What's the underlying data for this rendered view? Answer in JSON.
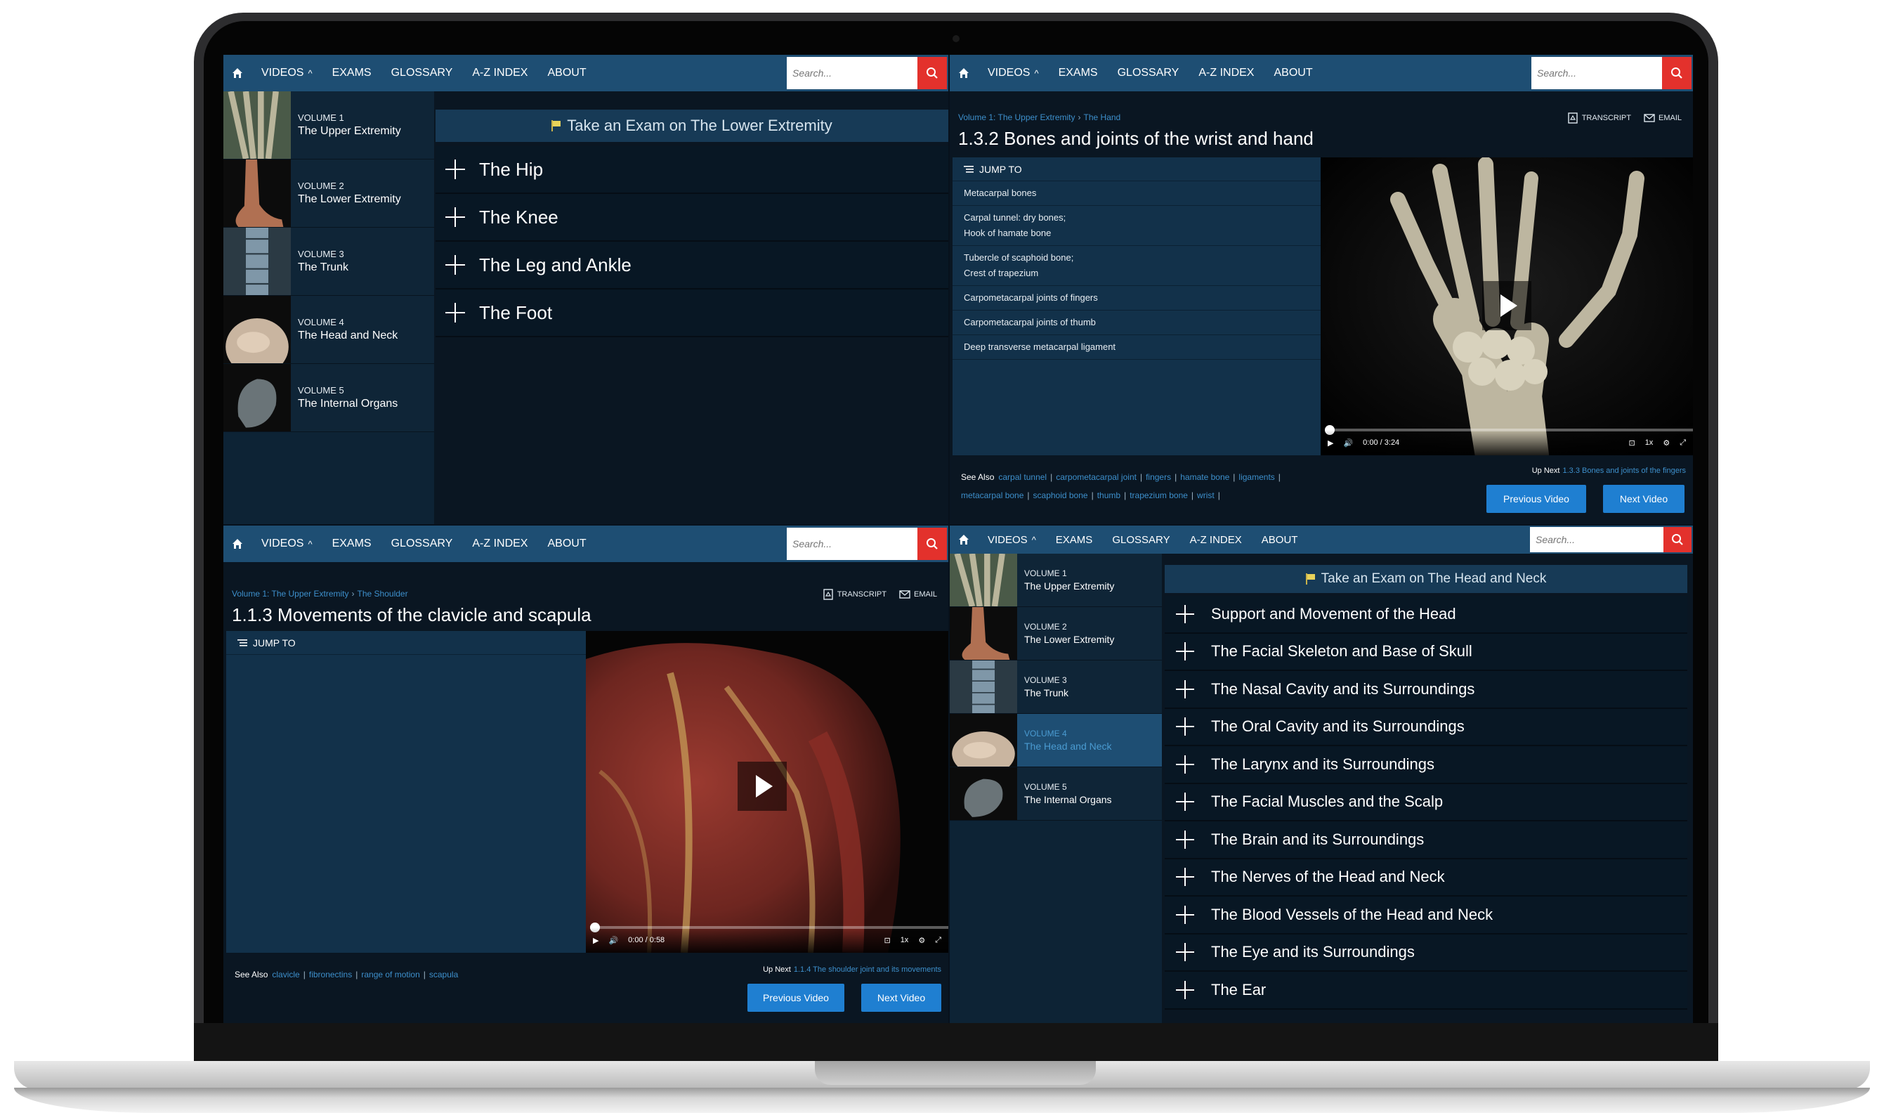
{
  "nav": {
    "items": [
      "VIDEOS",
      "EXAMS",
      "GLOSSARY",
      "A-Z INDEX",
      "ABOUT"
    ],
    "videos_chevron": "^",
    "search_placeholder": "Search..."
  },
  "volumes": [
    {
      "number": "VOLUME 1",
      "title": "The Upper Extremity"
    },
    {
      "number": "VOLUME 2",
      "title": "The Lower Extremity"
    },
    {
      "number": "VOLUME 3",
      "title": "The Trunk"
    },
    {
      "number": "VOLUME 4",
      "title": "The Head and Neck"
    },
    {
      "number": "VOLUME 5",
      "title": "The Internal Organs"
    }
  ],
  "panel_lower": {
    "exam_label": "Take an Exam on The Lower Extremity",
    "chapters": [
      "The Hip",
      "The Knee",
      "The Leg and Ankle",
      "The Foot"
    ]
  },
  "panel_wrist": {
    "breadcrumb": [
      "Volume 1: The Upper Extremity",
      "The Hand"
    ],
    "title": "1.3.2 Bones and joints of the wrist and hand",
    "transcript": "TRANSCRIPT",
    "email": "EMAIL",
    "jump_to": "JUMP TO",
    "jump_items": [
      [
        "Metacarpal bones"
      ],
      [
        "Carpal tunnel: dry bones;",
        "Hook of hamate bone"
      ],
      [
        "Tubercle of scaphoid bone;",
        "Crest of trapezium"
      ],
      [
        "Carpometacarpal joints of fingers"
      ],
      [
        "Carpometacarpal joints of thumb"
      ],
      [
        "Deep transverse metacarpal ligament"
      ]
    ],
    "time": "0:00",
    "duration": "/ 3:24",
    "speed": "1x",
    "progress": 0,
    "see_also_label": "See Also",
    "see_also_row1": [
      "carpal tunnel",
      "carpometacarpal joint",
      "fingers",
      "hamate bone",
      "ligaments"
    ],
    "see_also_row2": [
      "metacarpal bone",
      "scaphoid bone",
      "thumb",
      "trapezium bone",
      "wrist"
    ],
    "up_next_label": "Up Next",
    "up_next_link": "1.3.3 Bones and joints of the fingers",
    "prev_label": "Previous Video",
    "next_label": "Next Video"
  },
  "panel_shoulder": {
    "breadcrumb": [
      "Volume 1: The Upper Extremity",
      "The Shoulder"
    ],
    "title": "1.1.3 Movements of the clavicle and scapula",
    "transcript": "TRANSCRIPT",
    "email": "EMAIL",
    "jump_to": "JUMP TO",
    "time": "0:00",
    "duration": "/ 0:58",
    "speed": "1x",
    "progress": 0,
    "see_also_label": "See Also",
    "see_also": [
      "clavicle",
      "fibronectins",
      "range of motion",
      "scapula"
    ],
    "up_next_label": "Up Next",
    "up_next_link": "1.1.4 The shoulder joint and its movements",
    "prev_label": "Previous Video",
    "next_label": "Next Video"
  },
  "panel_head": {
    "exam_label": "Take an Exam on The Head and Neck",
    "active_volume": 3,
    "chapters": [
      "Support and Movement of the Head",
      "The Facial Skeleton and Base of Skull",
      "The Nasal Cavity and its Surroundings",
      "The Oral Cavity and its Surroundings",
      "The Larynx and its Surroundings",
      "The Facial Muscles and the Scalp",
      "The Brain and its Surroundings",
      "The Nerves of the Head and Neck",
      "The Blood Vessels of the Head and Neck",
      "The Eye and its Surroundings",
      "The Ear"
    ]
  },
  "colors": {
    "nav": "#1e4e73",
    "accent_link": "#3d8fcb",
    "button": "#1f7fd1",
    "search": "#e3312c"
  }
}
